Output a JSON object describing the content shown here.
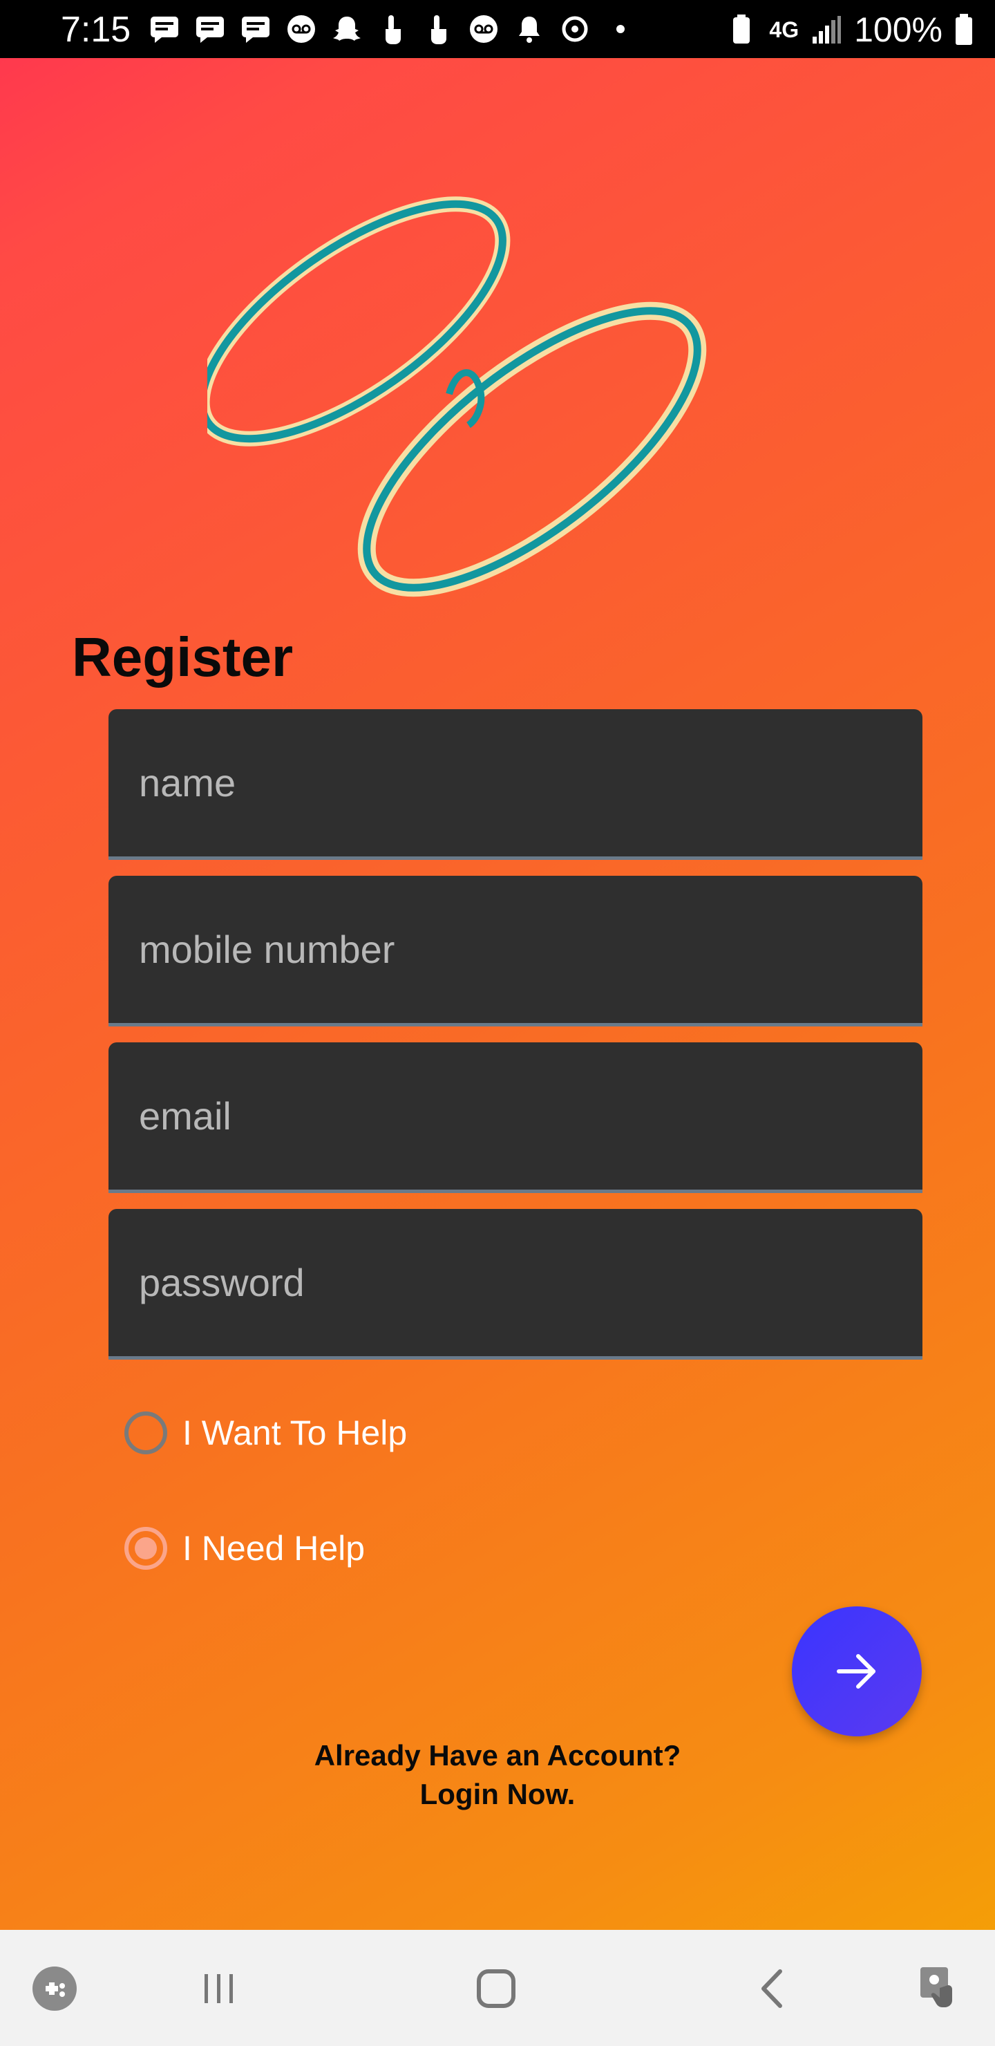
{
  "status_bar": {
    "time": "7:15",
    "battery_text": "100%",
    "network": "4G"
  },
  "register": {
    "title": "Register",
    "fields": {
      "name_placeholder": "name",
      "mobile_placeholder": "mobile number",
      "email_placeholder": "email",
      "password_placeholder": "password"
    },
    "options": {
      "want_to_help": "I Want To Help",
      "need_help": "I Need Help",
      "selected": "I Need Help"
    },
    "login_prompt": "Already Have an Account?",
    "login_action": "Login Now."
  },
  "colors": {
    "field_bg": "#2f2f2f",
    "fab": "#3a35ff",
    "radio_checked": "#fba58a"
  },
  "icons": {
    "fab": "arrow-right-icon",
    "nav": [
      "game-launcher-icon",
      "recent-apps-icon",
      "home-icon",
      "back-icon",
      "accessibility-icon"
    ]
  }
}
